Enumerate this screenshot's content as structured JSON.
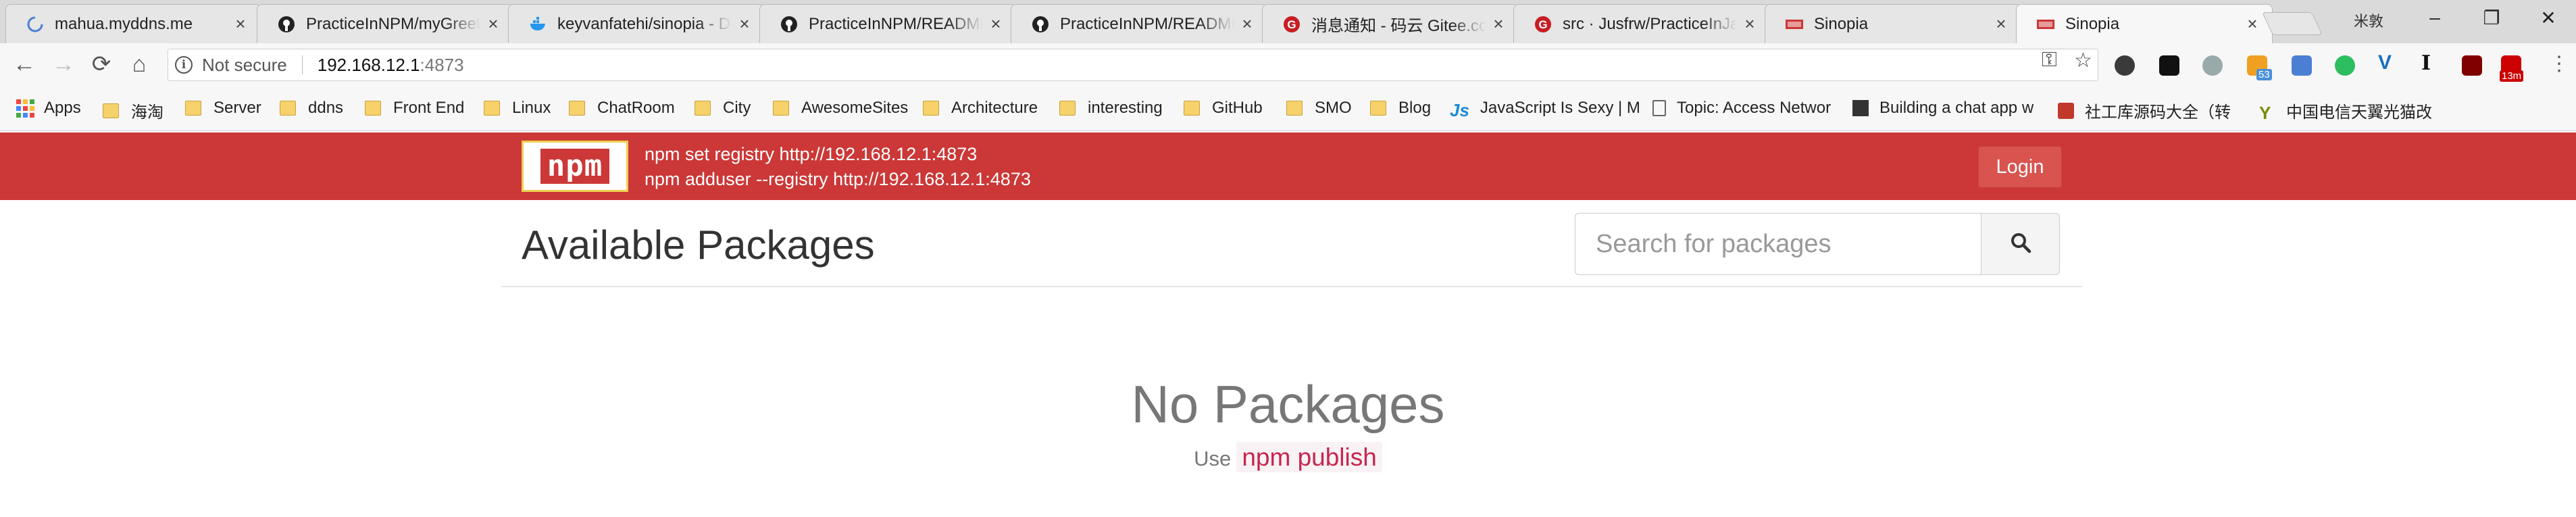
{
  "browser": {
    "tabs": [
      {
        "title": "mahua.myddns.me",
        "favicon": "loading-spinner-icon",
        "active": false
      },
      {
        "title": "PracticeInNPM/myGreeting",
        "favicon": "github-icon",
        "active": false
      },
      {
        "title": "keyvanfatehi/sinopia - Docker",
        "favicon": "docker-icon",
        "active": false
      },
      {
        "title": "PracticeInNPM/README.md",
        "favicon": "github-icon",
        "active": false
      },
      {
        "title": "PracticeInNPM/README.md",
        "favicon": "github-icon",
        "active": false
      },
      {
        "title": "消息通知 - 码云 Gitee.com",
        "favicon": "gitee-icon",
        "active": false
      },
      {
        "title": "src · Jusfrw/PracticeInJava",
        "favicon": "gitee-icon",
        "active": false
      },
      {
        "title": "Sinopia",
        "favicon": "npm-icon",
        "active": false
      },
      {
        "title": "Sinopia",
        "favicon": "npm-icon",
        "active": true
      }
    ],
    "window_user": "米敦",
    "address": {
      "security_label": "Not secure",
      "host": "192.168.12.1",
      "port": ":4873"
    },
    "extension_badges": {
      "rss": "53",
      "mail": "13m"
    },
    "bookmarks": [
      {
        "label": "Apps",
        "icon": "apps-grid-icon"
      },
      {
        "label": "海淘",
        "icon": "folder-icon"
      },
      {
        "label": "Server",
        "icon": "folder-icon"
      },
      {
        "label": "ddns",
        "icon": "folder-icon"
      },
      {
        "label": "Front End",
        "icon": "folder-icon"
      },
      {
        "label": "Linux",
        "icon": "folder-icon"
      },
      {
        "label": "ChatRoom",
        "icon": "folder-icon"
      },
      {
        "label": "City",
        "icon": "folder-icon"
      },
      {
        "label": "AwesomeSites",
        "icon": "folder-icon"
      },
      {
        "label": "Architecture",
        "icon": "folder-icon"
      },
      {
        "label": "interesting",
        "icon": "folder-icon"
      },
      {
        "label": "GitHub",
        "icon": "folder-icon"
      },
      {
        "label": "SMO",
        "icon": "folder-icon"
      },
      {
        "label": "Blog",
        "icon": "folder-icon"
      },
      {
        "label": "JavaScript Is Sexy | M",
        "icon": "js-icon"
      },
      {
        "label": "Topic: Access Networ",
        "icon": "page-icon"
      },
      {
        "label": "Building a chat app w",
        "icon": "qr-icon"
      },
      {
        "label": "社工库源码大全（转",
        "icon": "red-square-icon"
      },
      {
        "label": "中国电信天翼光猫改",
        "icon": "bookmark-y-icon"
      }
    ]
  },
  "npm_header": {
    "logo_text": "npm",
    "cmd_registry": "npm set registry http://192.168.12.1:4873",
    "cmd_adduser": "npm adduser --registry http://192.168.12.1:4873",
    "login_label": "Login"
  },
  "main": {
    "title": "Available Packages",
    "search_placeholder": "Search for packages",
    "empty_title": "No Packages",
    "empty_use": "Use",
    "empty_command": "npm publish"
  },
  "colors": {
    "brand": "#cb3837",
    "login_button": "#d9534f",
    "code_text": "#c7254e"
  }
}
